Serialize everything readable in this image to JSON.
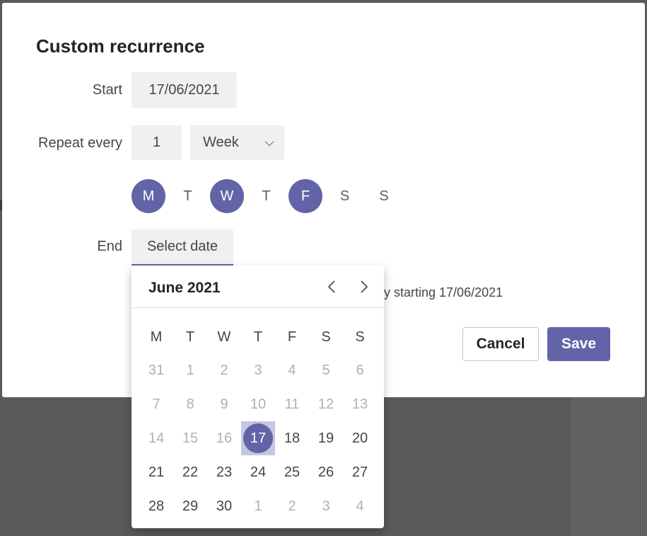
{
  "dialog": {
    "title": "Custom recurrence",
    "start_label": "Start",
    "start_value": "17/06/2021",
    "repeat_label": "Repeat every",
    "repeat_count": "1",
    "repeat_unit": "Week",
    "end_label": "End",
    "end_placeholder": "Select date",
    "summary_text": "y starting 17/06/2021",
    "cancel_label": "Cancel",
    "save_label": "Save"
  },
  "weekdays": [
    {
      "label": "M",
      "selected": true
    },
    {
      "label": "T",
      "selected": false
    },
    {
      "label": "W",
      "selected": true
    },
    {
      "label": "T",
      "selected": false
    },
    {
      "label": "F",
      "selected": true
    },
    {
      "label": "S",
      "selected": false
    },
    {
      "label": "S",
      "selected": false
    }
  ],
  "calendar": {
    "month_label": "June 2021",
    "prev_icon": "chevron-left-icon",
    "next_icon": "chevron-right-icon",
    "headers": [
      "M",
      "T",
      "W",
      "T",
      "F",
      "S",
      "S"
    ],
    "weeks": [
      [
        "31",
        "1",
        "2",
        "3",
        "4",
        "5",
        "6"
      ],
      [
        "7",
        "8",
        "9",
        "10",
        "11",
        "12",
        "13"
      ],
      [
        "14",
        "15",
        "16",
        "17",
        "18",
        "19",
        "20"
      ],
      [
        "21",
        "22",
        "23",
        "24",
        "25",
        "26",
        "27"
      ],
      [
        "28",
        "29",
        "30",
        "1",
        "2",
        "3",
        "4"
      ]
    ],
    "muted": [
      [
        true,
        true,
        true,
        true,
        true,
        true,
        true
      ],
      [
        true,
        true,
        true,
        true,
        true,
        true,
        true
      ],
      [
        true,
        true,
        true,
        false,
        false,
        false,
        false
      ],
      [
        false,
        false,
        false,
        false,
        false,
        false,
        false
      ],
      [
        false,
        false,
        false,
        true,
        true,
        true,
        true
      ]
    ],
    "today": "17"
  },
  "colors": {
    "accent": "#6264a7",
    "today_highlight": "#c5c6e4"
  }
}
